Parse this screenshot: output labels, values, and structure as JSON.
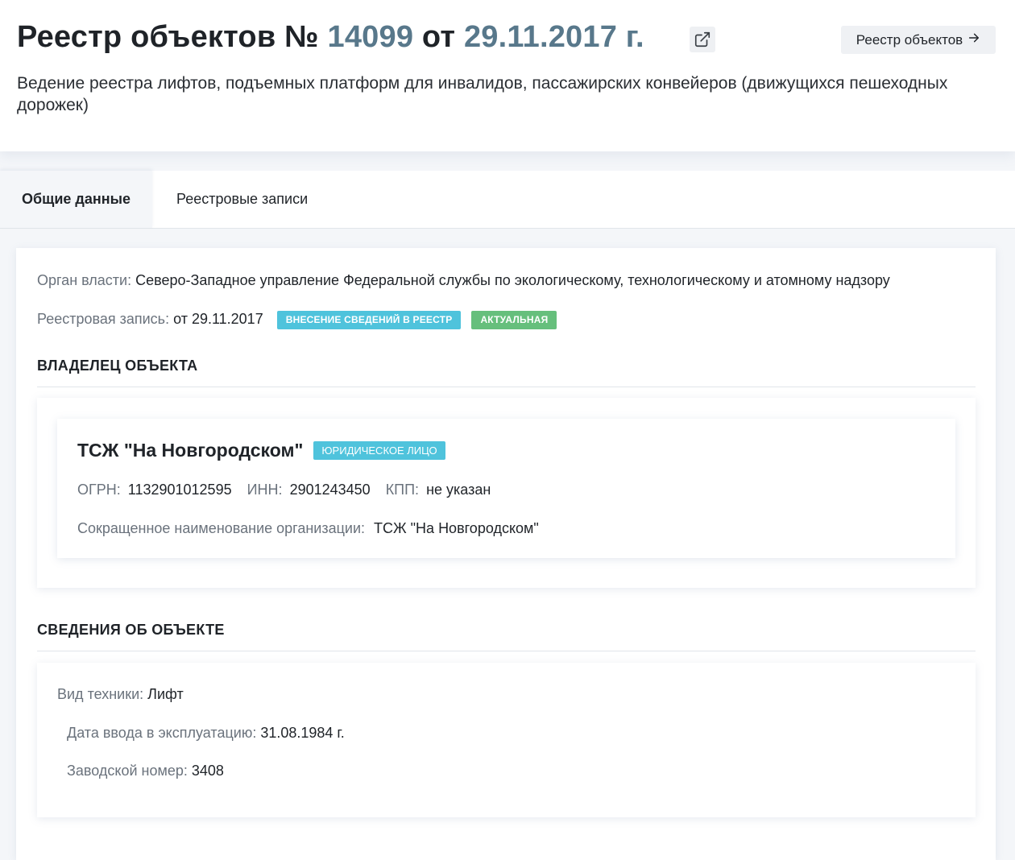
{
  "header": {
    "title_prefix": "Реестр объектов № ",
    "number": "14099",
    "title_mid": " от ",
    "date": "29.11.2017 г.",
    "external_link_icon": "external-link-icon",
    "registry_button_label": "Реестр объектов",
    "registry_button_icon": "arrow-right-icon",
    "subtitle": "Ведение реестра лифтов, подъемных платформ для инвалидов, пассажирских конвейеров (движущихся пешеходных дорожек)"
  },
  "tabs": [
    {
      "label": "Общие данные",
      "active": true
    },
    {
      "label": "Реестровые записи",
      "active": false
    }
  ],
  "general": {
    "authority_label": "Орган власти:",
    "authority_value": "Северо-Западное управление Федеральной службы по экологическому, технологическому и атомному надзору",
    "record_label": "Реестровая запись:",
    "record_value": "от 29.11.2017",
    "record_badges": [
      {
        "text": "ВНЕСЕНИЕ СВЕДЕНИЙ В РЕЕСТР",
        "color": "#4fc3dc"
      },
      {
        "text": "АКТУАЛЬНАЯ",
        "color": "#66bf7c"
      }
    ]
  },
  "owner_section": {
    "title": "ВЛАДЕЛЕЦ ОБЪЕКТА",
    "name": "ТСЖ \"На Новгородском\"",
    "type_badge": "ЮРИДИЧЕСКОЕ ЛИЦО",
    "ogrn_label": "ОГРН:",
    "ogrn_value": "1132901012595",
    "inn_label": "ИНН:",
    "inn_value": "2901243450",
    "kpp_label": "КПП:",
    "kpp_value": "не указан",
    "short_name_label": "Сокращенное наименование организации:",
    "short_name_value": "ТСЖ \"На Новгородском\""
  },
  "object_section": {
    "title": "СВЕДЕНИЯ ОБ ОБЪЕКТЕ",
    "equipment_label": "Вид техники:",
    "equipment_value": "Лифт",
    "commission_label": "Дата ввода в эксплуатацию:",
    "commission_value": "31.08.1984 г.",
    "serial_label": "Заводской номер:",
    "serial_value": "3408"
  },
  "colors": {
    "accent_number": "#58788b",
    "badge_blue": "#4fc3dc",
    "badge_green": "#66bf7c"
  }
}
